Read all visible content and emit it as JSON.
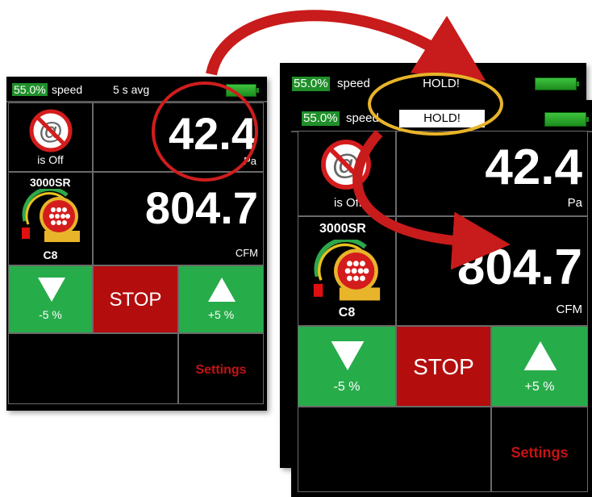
{
  "screen": {
    "speed_percent": "55.0%",
    "speed_word": "speed",
    "avg_label": "5 s avg",
    "hold_label": "HOLD!",
    "off_label": "is Off",
    "model": "3000SR",
    "ring": "C8",
    "pressure_value": "42.4",
    "pressure_unit": "Pa",
    "flow_value": "804.7",
    "flow_unit": "CFM",
    "down_label": "-5 %",
    "stop_label": "STOP",
    "up_label": "+5 %",
    "settings_label": "Settings"
  },
  "colors": {
    "green": "#27ac4a",
    "red": "#b40d0d",
    "settings_red": "#c41313",
    "circle_red": "#d41c1c",
    "circle_gold": "#e8b42a"
  },
  "icons": [
    "no-wifi-icon",
    "fan-ring-icon",
    "arrow-down-icon",
    "arrow-up-icon",
    "battery-icon"
  ]
}
